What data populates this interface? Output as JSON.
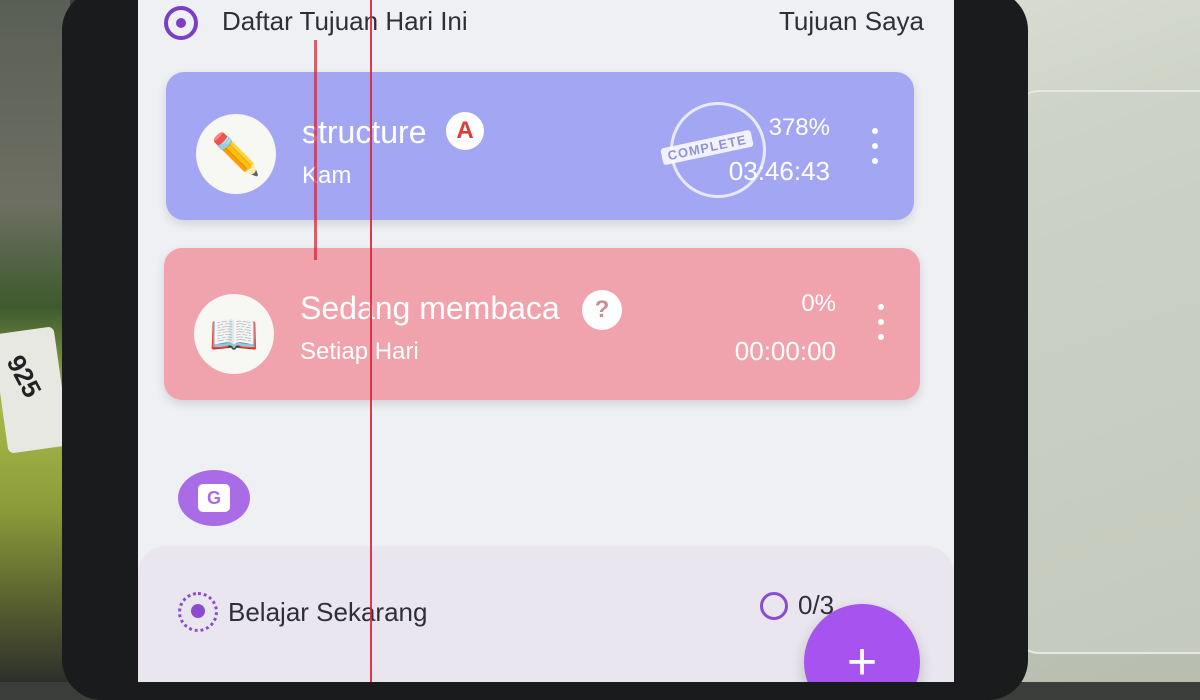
{
  "header": {
    "title": "Daftar Tujuan Hari Ini",
    "right_link": "Tujuan Saya"
  },
  "goals": [
    {
      "name": "structure",
      "subtitle": "Kam",
      "badge": "A",
      "percent": "378%",
      "time": "03:46:43",
      "status_stamp": "COMPLETE",
      "icon": "pencil-icon",
      "color": "#a3a7f3"
    },
    {
      "name": "Sedang membaca",
      "subtitle": "Setiap Hari",
      "badge": "?",
      "percent": "0%",
      "time": "00:00:00",
      "icon": "book-icon",
      "color": "#f0a3ac"
    }
  ],
  "g_button_label": "G",
  "learn": {
    "label": "Belajar Sekarang",
    "count": "0/3"
  },
  "fab_label": "+",
  "accent": "#a653ef"
}
